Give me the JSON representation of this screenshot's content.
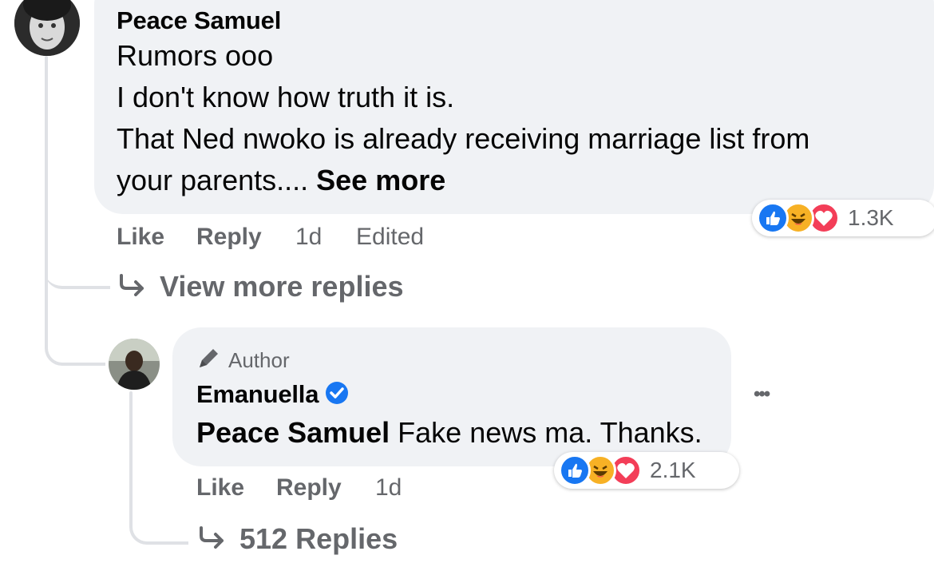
{
  "comment": {
    "author": "Peace Samuel",
    "lines": [
      "Rumors ooo",
      "I don't know how truth it is.",
      "That Ned nwoko is already receiving marriage list from",
      "your parents...."
    ],
    "see_more": "See more",
    "actions": {
      "like": "Like",
      "reply": "Reply",
      "time": "1d",
      "edited": "Edited"
    },
    "reactions": {
      "icons": [
        "like-icon",
        "haha-icon",
        "love-icon"
      ],
      "count": "1.3K"
    }
  },
  "view_more_replies": "View more replies",
  "reply": {
    "badge": "Author",
    "author": "Emanuella",
    "verified": true,
    "mention": "Peace Samuel",
    "text": " Fake news ma. Thanks.",
    "actions": {
      "like": "Like",
      "reply": "Reply",
      "time": "1d"
    },
    "reactions": {
      "icons": [
        "like-icon",
        "haha-icon",
        "love-icon"
      ],
      "count": "2.1K"
    },
    "more_menu": "•••"
  },
  "replies_link": "512 Replies",
  "colors": {
    "like": "#1877f2",
    "haha": "#f7b125",
    "love": "#f33e58",
    "bubble": "#f0f2f5",
    "meta": "#65676b"
  }
}
